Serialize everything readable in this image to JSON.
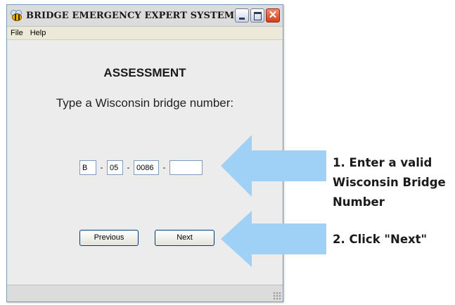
{
  "window": {
    "title": "BRIDGE EMERGENCY EXPERT SYSTEM",
    "icon": "bee-icon",
    "controls": [
      "minimize-icon",
      "maximize-icon",
      "close-icon"
    ],
    "close_glyph": "✕"
  },
  "menu": {
    "items": [
      {
        "label": "File"
      },
      {
        "label": "Help"
      }
    ]
  },
  "assessment": {
    "heading": "ASSESSMENT",
    "prompt": "Type a Wisconsin bridge number:",
    "bridge_number": {
      "part1": "B",
      "sep1": "-",
      "part2": "05",
      "sep2": "-",
      "part3": "0086",
      "sep3": "-",
      "part4": ""
    }
  },
  "buttons": {
    "previous_label": "Previous",
    "next_label": "Next"
  },
  "annotations": {
    "arrow_color": "#9fd0f5",
    "step1": [
      "1. Enter a valid",
      "Wisconsin Bridge",
      "Number"
    ],
    "step2": "2. Click \"Next\""
  }
}
